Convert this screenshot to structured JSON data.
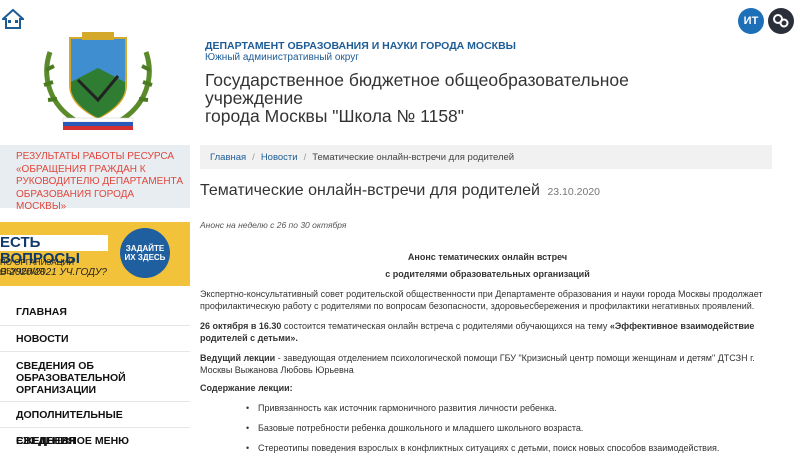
{
  "top_icons": {
    "home": "home-icon",
    "it": "ИТ",
    "settings": "gear-icon"
  },
  "header": {
    "department": "ДЕПАРТАМЕНТ ОБРАЗОВАНИЯ И НАУКИ ГОРОДА МОСКВЫ",
    "district": "Южный административный округ",
    "school_line1": "Государственное бюджетное общеобразовательное учреждение",
    "school_line2": "города Москвы \"Школа № 1158\""
  },
  "sidebar": {
    "results_link": "РЕЗУЛЬТАТЫ РАБОТЫ РЕСУРСА «ОБРАЩЕНИЯ ГРАЖДАН К РУКОВОДИТЕЛЮ ДЕПАРТАМЕНТА ОБРАЗОВАНИЯ ГОРОДА МОСКВЫ»",
    "banner": {
      "title": "ЕСТЬ ВОПРОСЫ",
      "subtitle": "ПО ОРГАНИЗАЦИИ ОБУЧЕНИЯ",
      "big": "В 2020/2021 УЧ.ГОДУ?",
      "badge": "ЗАДАЙТЕ ИХ ЗДЕСЬ"
    },
    "menu": [
      "ГЛАВНАЯ",
      "НОВОСТИ",
      "СВЕДЕНИЯ ОБ ОБРАЗОВАТЕЛЬНОЙ ОРГАНИЗАЦИИ",
      "ДОПОЛНИТЕЛЬНЫЕ СВЕДЕНИЯ",
      "ЕЖЕДНЕВНОЕ МЕНЮ"
    ]
  },
  "breadcrumb": {
    "home": "Главная",
    "news": "Новости",
    "current": "Тематические онлайн-встречи для родителей",
    "sep": "/"
  },
  "article": {
    "title": "Тематические онлайн-встречи для родителей",
    "date": "23.10.2020",
    "anons": "Анонс на неделю с 26 по 30 октября",
    "center1": "Анонс тематических онлайн встреч",
    "center2": "с родителями образовательных организаций",
    "para1": "Экспертно-консультативный совет родительской общественности при Департаменте образования и науки города Москвы продолжает профилактическую работу с родителями по вопросам безопасности, здоровьесбережения и профилактики негативных проявлений.",
    "para2_bold": "26 октября в 16.30",
    "para2_text": " состоится тематическая онлайн встреча с родителями обучающихся на тему ",
    "para2_topic": "«Эффективное взаимодействие родителей с детьми».",
    "para3_bold": "Ведущий лекции",
    "para3_text": " - заведующая отделением психологической помощи ГБУ \"Кризисный центр помощи женщинам и детям\" ДТСЗН г. Москвы Выжанова Любовь Юрьевна",
    "para4": "Содержание лекции:",
    "bullets": [
      "Привязанность как источник гармоничного развития личности ребенка.",
      "Базовые потребности ребенка дошкольного и младшего школьного возраста.",
      "Стереотипы поведения взрослых в конфликтных ситуациях с детьми, поиск новых способов взаимодействия."
    ]
  },
  "colors": {
    "accent_blue": "#1e5c95",
    "results_red": "#e0463c",
    "banner_yellow": "#f2c23b",
    "sidebar_bg": "#e8edf1"
  }
}
